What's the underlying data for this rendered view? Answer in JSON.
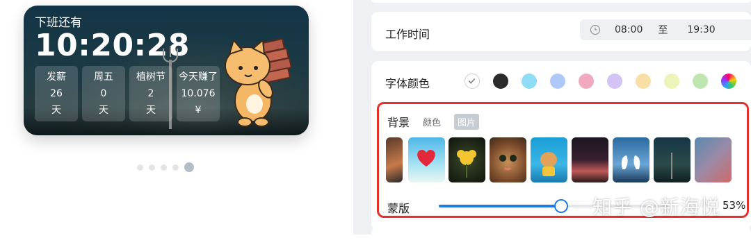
{
  "widget": {
    "title": "下班还有",
    "countdown": "10:20:28",
    "cells": [
      {
        "label": "发薪",
        "value": "26",
        "unit": "天"
      },
      {
        "label": "周五",
        "value": "0",
        "unit": "天"
      },
      {
        "label": "植树节",
        "value": "2",
        "unit": "天"
      },
      {
        "label": "今天赚了",
        "value": "10.076",
        "unit": "¥"
      }
    ]
  },
  "pager": {
    "count": 5,
    "active_index": 4
  },
  "settings": {
    "work_time": {
      "label": "工作时间",
      "start": "08:00",
      "separator": "至",
      "end": "19:30"
    },
    "font_color": {
      "label": "字体颜色",
      "swatches": [
        "#ffffff",
        "#2b2b2b",
        "#8fdcf5",
        "#aec9f7",
        "#f1a9c0",
        "#d4c3f5",
        "#f7dfa6",
        "#eef3b8",
        "#bfe6b0",
        "gradient"
      ]
    },
    "background": {
      "label": "背景",
      "tabs": [
        "颜色",
        "图片"
      ],
      "active_tab": "图片",
      "mask_label": "蒙版",
      "mask_percent": 53,
      "mask_suffix": "%"
    }
  },
  "watermark": "知乎 @新海悦",
  "colors": {
    "accent": "#1f7be0",
    "highlight": "#e3312d"
  }
}
